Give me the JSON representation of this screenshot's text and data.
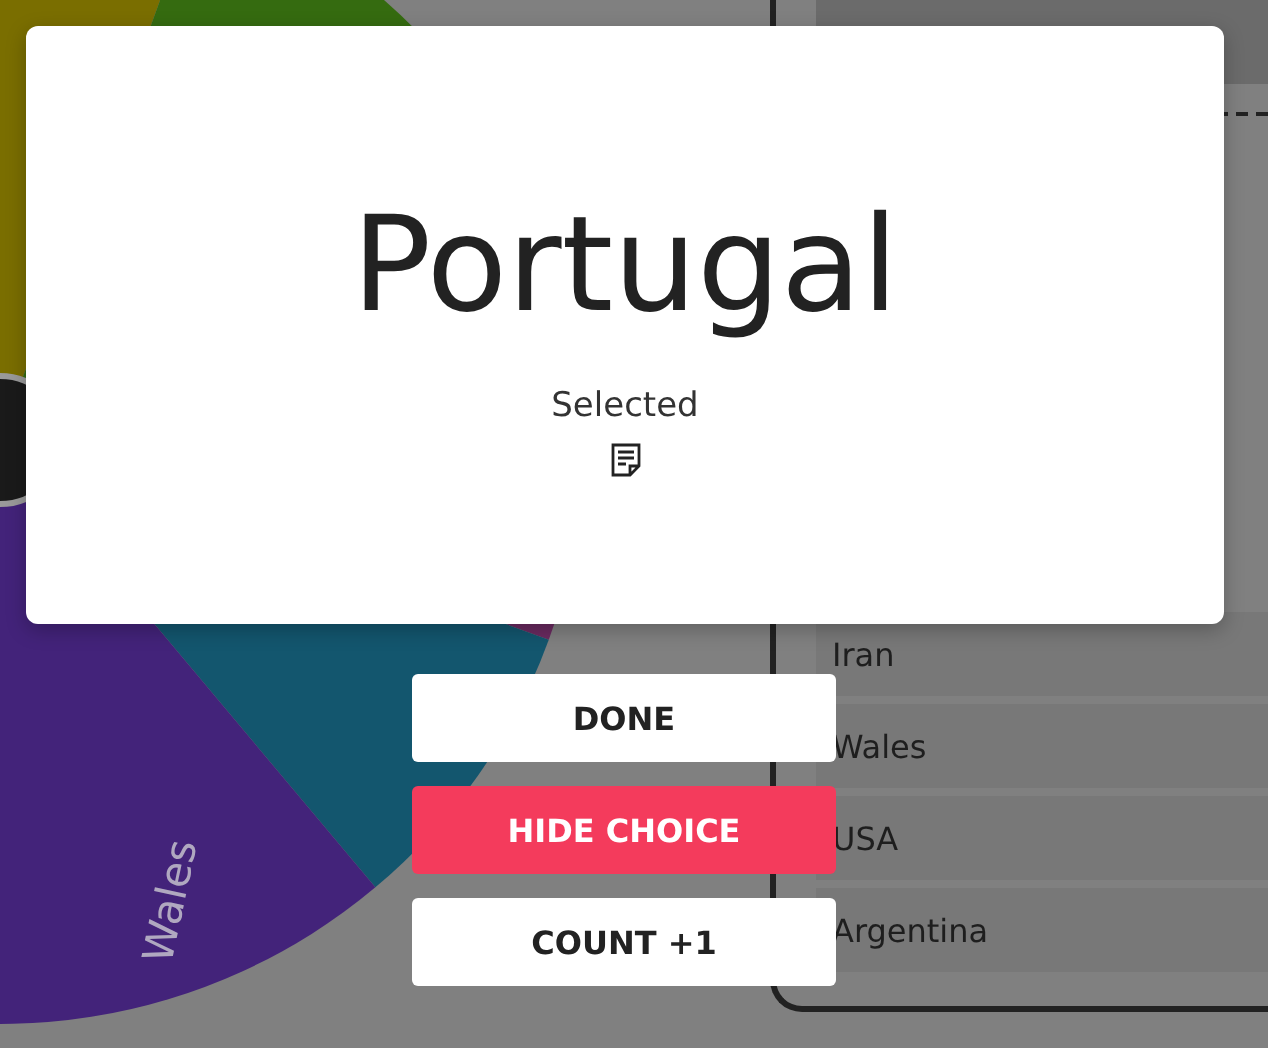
{
  "wheel": {
    "labels": [
      {
        "text": "Wales"
      }
    ]
  },
  "list": {
    "items": [
      "Iran",
      "Wales",
      "USA",
      "Argentina"
    ]
  },
  "dialog": {
    "choice": "Portugal",
    "caption": "Selected"
  },
  "buttons": [
    {
      "label": "DONE",
      "kind": "plain"
    },
    {
      "label": "HIDE CHOICE",
      "kind": "danger"
    },
    {
      "label": "COUNT +1",
      "kind": "plain"
    }
  ]
}
